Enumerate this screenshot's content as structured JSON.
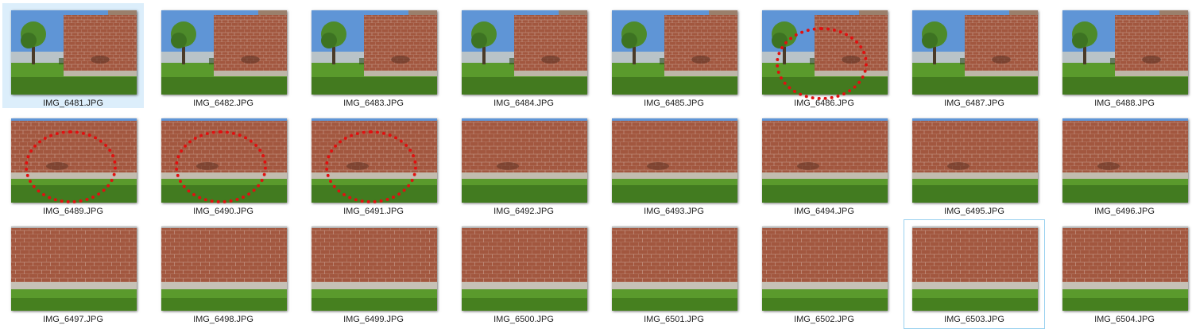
{
  "files": [
    {
      "name": "IMG_6481.JPG",
      "view": "wide"
    },
    {
      "name": "IMG_6482.JPG",
      "view": "wide"
    },
    {
      "name": "IMG_6483.JPG",
      "view": "wide"
    },
    {
      "name": "IMG_6484.JPG",
      "view": "wide"
    },
    {
      "name": "IMG_6485.JPG",
      "view": "wide"
    },
    {
      "name": "IMG_6486.JPG",
      "view": "wide"
    },
    {
      "name": "IMG_6487.JPG",
      "view": "wide"
    },
    {
      "name": "IMG_6488.JPG",
      "view": "wide"
    },
    {
      "name": "IMG_6489.JPG",
      "view": "mid"
    },
    {
      "name": "IMG_6490.JPG",
      "view": "mid"
    },
    {
      "name": "IMG_6491.JPG",
      "view": "mid"
    },
    {
      "name": "IMG_6492.JPG",
      "view": "mid"
    },
    {
      "name": "IMG_6493.JPG",
      "view": "mid"
    },
    {
      "name": "IMG_6494.JPG",
      "view": "mid"
    },
    {
      "name": "IMG_6495.JPG",
      "view": "mid"
    },
    {
      "name": "IMG_6496.JPG",
      "view": "mid"
    },
    {
      "name": "IMG_6497.JPG",
      "view": "close"
    },
    {
      "name": "IMG_6498.JPG",
      "view": "close"
    },
    {
      "name": "IMG_6499.JPG",
      "view": "close"
    },
    {
      "name": "IMG_6500.JPG",
      "view": "close"
    },
    {
      "name": "IMG_6501.JPG",
      "view": "close"
    },
    {
      "name": "IMG_6502.JPG",
      "view": "close"
    },
    {
      "name": "IMG_6503.JPG",
      "view": "close"
    },
    {
      "name": "IMG_6504.JPG",
      "view": "close"
    }
  ],
  "selected_file": "IMG_6481.JPG",
  "focused_file": "IMG_6503.JPG",
  "annotated_files": [
    "IMG_6486.JPG",
    "IMG_6489.JPG",
    "IMG_6490.JPG",
    "IMG_6491.JPG"
  ],
  "colors": {
    "selection_fill": "#dceefb",
    "focus_border": "#99d1ef",
    "annotation": "#e01010",
    "brick": "#a2573f",
    "grass": "#5a9a2c",
    "sky": "#5f95d6"
  }
}
